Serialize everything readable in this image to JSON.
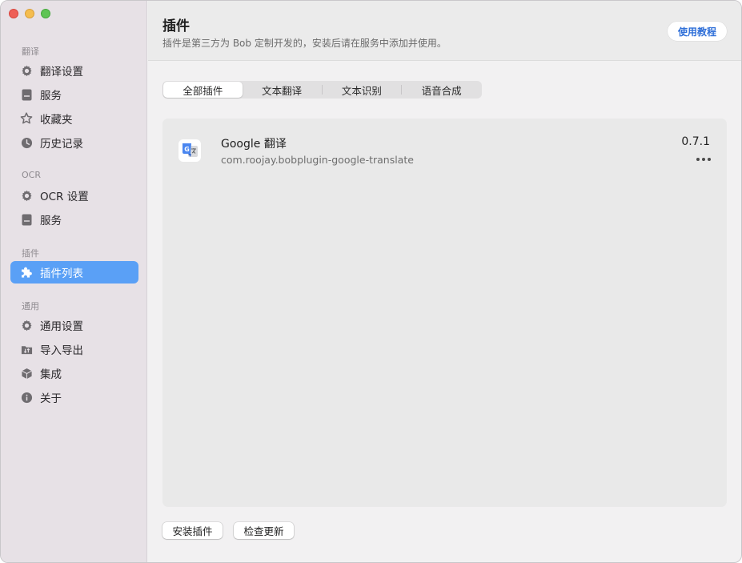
{
  "sidebar": {
    "sections": [
      {
        "title": "翻译",
        "items": [
          {
            "label": "翻译设置",
            "icon": "gear-icon"
          },
          {
            "label": "服务",
            "icon": "bookmark-icon"
          },
          {
            "label": "收藏夹",
            "icon": "star-icon"
          },
          {
            "label": "历史记录",
            "icon": "clock-icon"
          }
        ]
      },
      {
        "title": "OCR",
        "items": [
          {
            "label": "OCR 设置",
            "icon": "gear-icon"
          },
          {
            "label": "服务",
            "icon": "bookmark-icon"
          }
        ]
      },
      {
        "title": "插件",
        "items": [
          {
            "label": "插件列表",
            "icon": "puzzle-icon",
            "active": true
          }
        ]
      },
      {
        "title": "通用",
        "items": [
          {
            "label": "通用设置",
            "icon": "gear-icon"
          },
          {
            "label": "导入导出",
            "icon": "import-export-icon"
          },
          {
            "label": "集成",
            "icon": "cube-icon"
          },
          {
            "label": "关于",
            "icon": "info-icon"
          }
        ]
      }
    ]
  },
  "header": {
    "title": "插件",
    "subtitle": "插件是第三方为 Bob 定制开发的，安装后请在服务中添加并使用。",
    "tutorial_label": "使用教程"
  },
  "tabs": [
    {
      "label": "全部插件",
      "active": true
    },
    {
      "label": "文本翻译"
    },
    {
      "label": "文本识别"
    },
    {
      "label": "语音合成"
    }
  ],
  "plugins": [
    {
      "name": "Google 翻译",
      "id": "com.roojay.bobplugin-google-translate",
      "version": "0.7.1"
    }
  ],
  "footer": {
    "install_label": "安装插件",
    "update_label": "检查更新"
  },
  "colors": {
    "accent": "#5aa0f6",
    "sidebar_bg": "#e7e1e6",
    "link": "#2f6fd8"
  }
}
